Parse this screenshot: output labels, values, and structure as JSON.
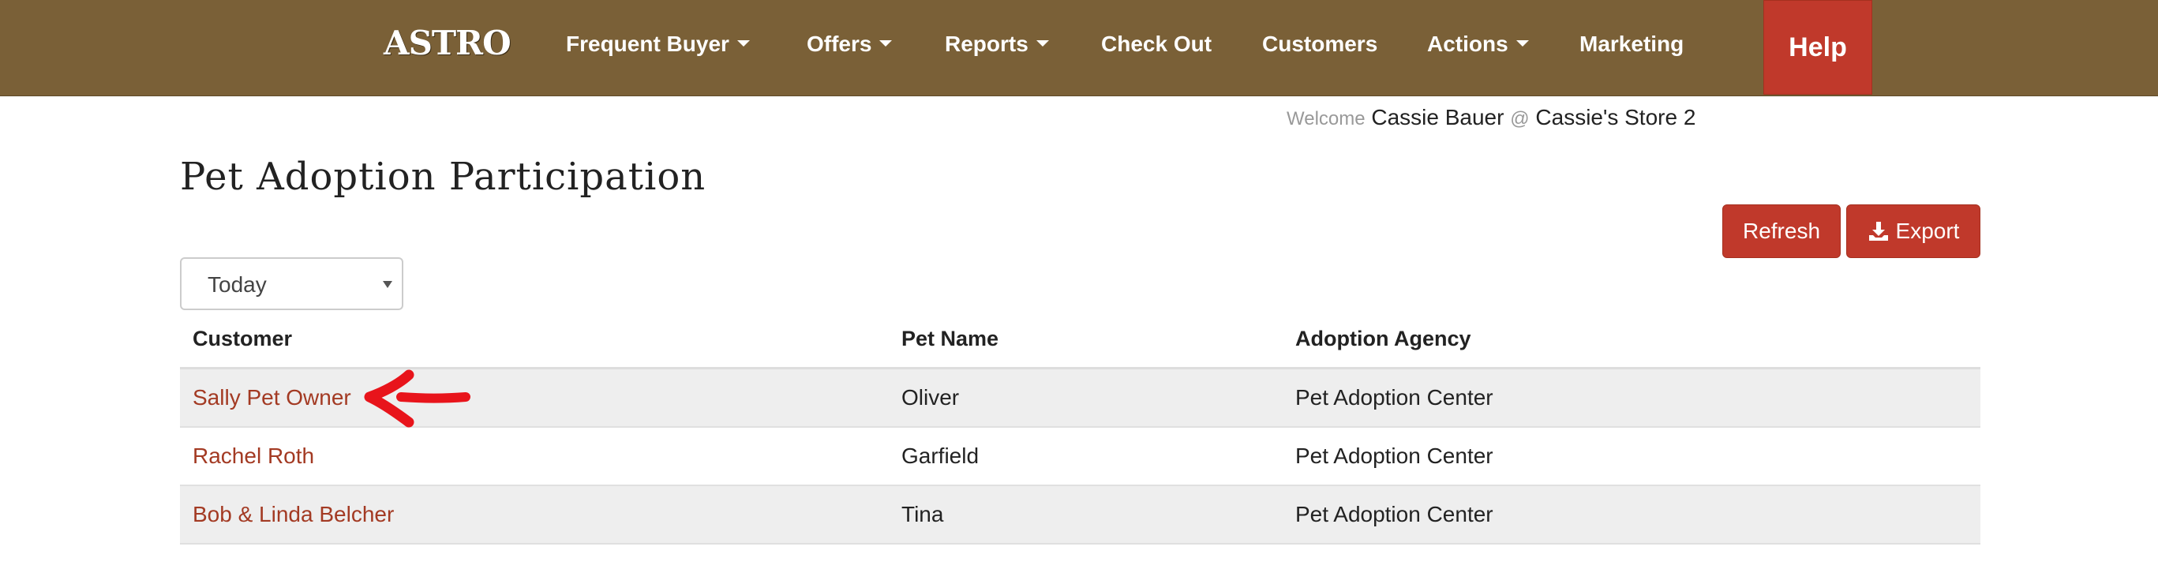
{
  "navbar": {
    "brand": "ASTRO",
    "items": [
      {
        "label": "Frequent Buyer",
        "dropdown": true
      },
      {
        "label": "Offers",
        "dropdown": true
      },
      {
        "label": "Reports",
        "dropdown": true
      },
      {
        "label": "Check Out",
        "dropdown": false
      },
      {
        "label": "Customers",
        "dropdown": false
      },
      {
        "label": "Actions",
        "dropdown": true
      },
      {
        "label": "Marketing",
        "dropdown": false
      }
    ],
    "help": "Help"
  },
  "welcome": {
    "prefix": "Welcome",
    "user": "Cassie Bauer",
    "at": "@",
    "store": "Cassie's Store 2"
  },
  "page": {
    "title": "Pet Adoption Participation"
  },
  "actions": {
    "refresh": "Refresh",
    "export": "Export",
    "export_icon": "download-icon"
  },
  "filter": {
    "selected": "Today"
  },
  "table": {
    "headers": [
      "Customer",
      "Pet Name",
      "Adoption Agency"
    ],
    "rows": [
      {
        "customer": "Sally Pet Owner",
        "pet": "Oliver",
        "agency": "Pet Adoption Center"
      },
      {
        "customer": "Rachel Roth",
        "pet": "Garfield",
        "agency": "Pet Adoption Center"
      },
      {
        "customer": "Bob & Linda Belcher",
        "pet": "Tina",
        "agency": "Pet Adoption Center"
      }
    ]
  },
  "colors": {
    "navbar": "#7a6037",
    "accent": "#c0392b",
    "link": "#a33a23",
    "annotation": "#e8141b"
  }
}
